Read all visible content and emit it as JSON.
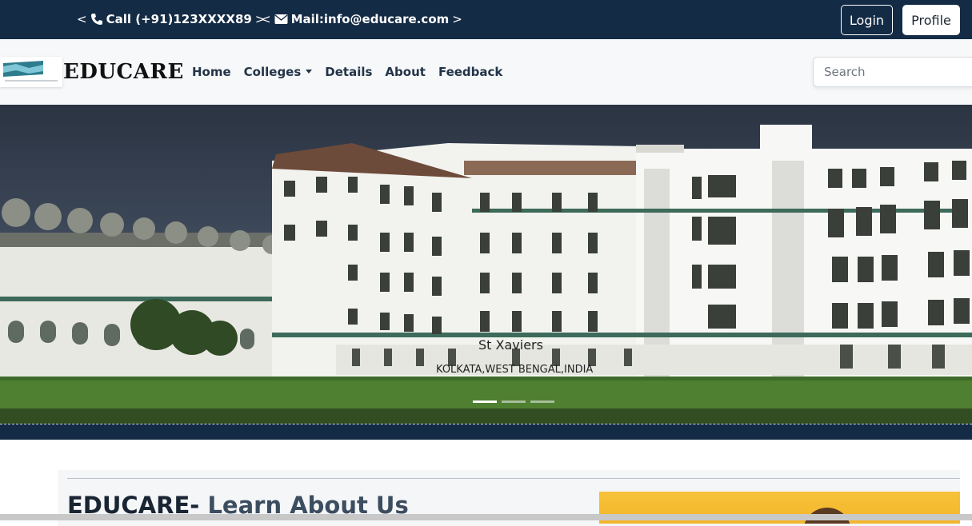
{
  "topbar": {
    "phone": "Call (+91)123XXXX89",
    "mail": "Mail:info@educare.com",
    "bracket_open": "<",
    "bracket_close": ">",
    "login_label": "Login",
    "profile_label": "Profile"
  },
  "navbar": {
    "brand": "EDUCARE",
    "links": [
      "Home",
      "Colleges",
      "Details",
      "About",
      "Feedback"
    ],
    "search_placeholder": "Search"
  },
  "hero": {
    "caption_title": "St Xaviers",
    "caption_sub": "KOLKATA,WEST BENGAL,INDIA",
    "slide_count": 3,
    "active_slide": 1
  },
  "about": {
    "title_bold": "EDUCARE-",
    "title_muted": " Learn About Us"
  },
  "colors": {
    "topbar_bg": "#142b45",
    "nav_bg": "#f6f8fa",
    "nav_text": "#233448",
    "accent_image": "#f7c23a"
  },
  "icons": [
    "phone-icon",
    "envelope-icon",
    "caret-down-icon"
  ]
}
